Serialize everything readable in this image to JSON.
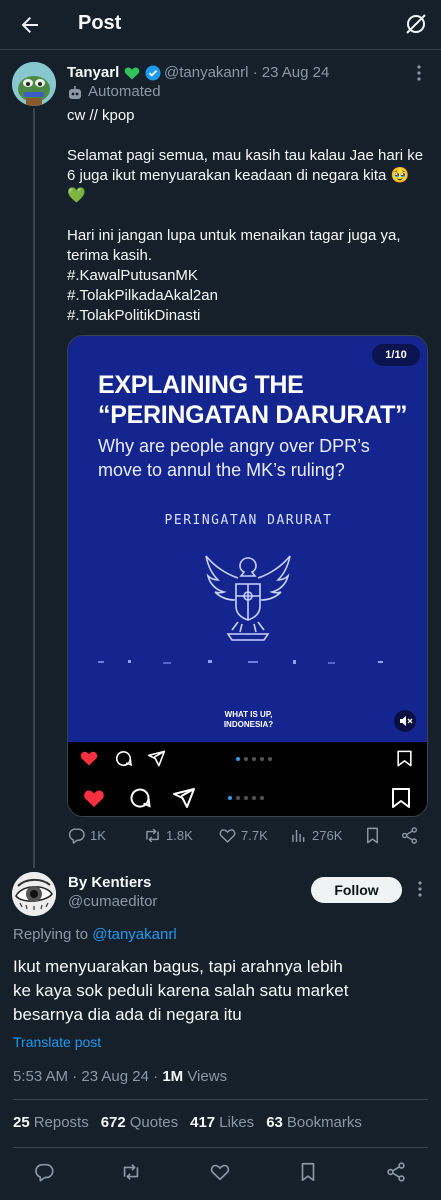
{
  "header": {
    "title": "Post"
  },
  "post": {
    "author_name": "Tanyarl",
    "handle": "@tanyakanrl",
    "date": "23 Aug 24",
    "automated_label": "Automated",
    "body_paragraphs": [
      "cw // kpop",
      "Selamat pagi semua, mau kasih tau kalau Jae hari ke 6 juga ikut menyuarakan keadaan di negara kita 🥹 💚",
      "Hari ini jangan lupa untuk menaikan tagar juga ya, terima kasih.\n#.KawalPutusanMK\n#.TolakPilkadaAkal2an\n#.TolakPolitikDinasti"
    ],
    "media": {
      "slide_counter": "1/10",
      "headline": "EXPLAINING THE\n“PERINGATAN DARURAT”",
      "subheadline": "Why are people angry over DPR’s\nmove to annul the MK’s ruling?",
      "caption": "PERINGATAN DARURAT",
      "footer": "WHAT IS UP,\nINDONESIA?"
    },
    "actions": {
      "replies": "1K",
      "reposts": "1.8K",
      "likes": "7.7K",
      "views": "276K"
    }
  },
  "reply": {
    "author_name": "By Kentiers",
    "handle": "@cumaeditor",
    "follow_label": "Follow",
    "replying_prefix": "Replying to ",
    "replying_to": "@tanyakanrl",
    "body": "Ikut menyuarakan bagus, tapi arahnya lebih\nke kaya sok peduli karena salah satu market\nbesarnya dia ada di negara itu",
    "translate_label": "Translate post",
    "time": "5:53 AM",
    "date": "23 Aug 24",
    "views_count": "1M",
    "views_label": "Views",
    "stats": {
      "reposts_count": "25",
      "reposts_label": "Reposts",
      "quotes_count": "672",
      "quotes_label": "Quotes",
      "likes_count": "417",
      "likes_label": "Likes",
      "bookmarks_count": "63",
      "bookmarks_label": "Bookmarks"
    }
  },
  "colors": {
    "background": "#15202b",
    "accent": "#1d9bf0",
    "muted": "#8b98a5",
    "divider": "#38444d",
    "instagram_like": "#ff3040",
    "media_blue": "#14258f"
  }
}
